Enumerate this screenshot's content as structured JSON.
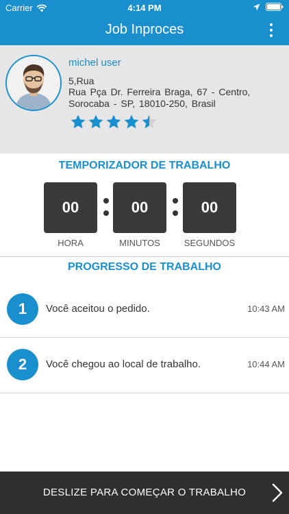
{
  "status_bar": {
    "carrier": "Carrier",
    "time": "4:14 PM"
  },
  "header": {
    "title": "Job Inproces"
  },
  "profile": {
    "name": "michel user",
    "address_line1": "5,Rua",
    "address_line2": "Rua Pça Dr. Ferreira Braga, 67 - Centro, Sorocaba - SP, 18010-250, Brasil",
    "rating": 4.5,
    "rating_max": 5
  },
  "timer": {
    "title": "TEMPORIZADOR DE TRABALHO",
    "hours": "00",
    "minutes": "00",
    "seconds": "00",
    "hours_label": "HORA",
    "minutes_label": "MINUTOS",
    "seconds_label": "SEGUNDOS"
  },
  "progress": {
    "title": "PROGRESSO DE TRABALHO",
    "steps": [
      {
        "number": "1",
        "text": "Você aceitou o pedido.",
        "time": "10:43 AM"
      },
      {
        "number": "2",
        "text": "Você chegou ao local de trabalho.",
        "time": "10:44 AM"
      }
    ]
  },
  "swipe": {
    "label": "DESLIZE PARA COMEÇAR O TRABALHO"
  },
  "colors": {
    "primary": "#1a8fcd",
    "dark": "#3a3a3a",
    "bar": "#2f2f2f",
    "profile_bg": "#e6e6e6",
    "star_empty": "#d0d0d0"
  }
}
